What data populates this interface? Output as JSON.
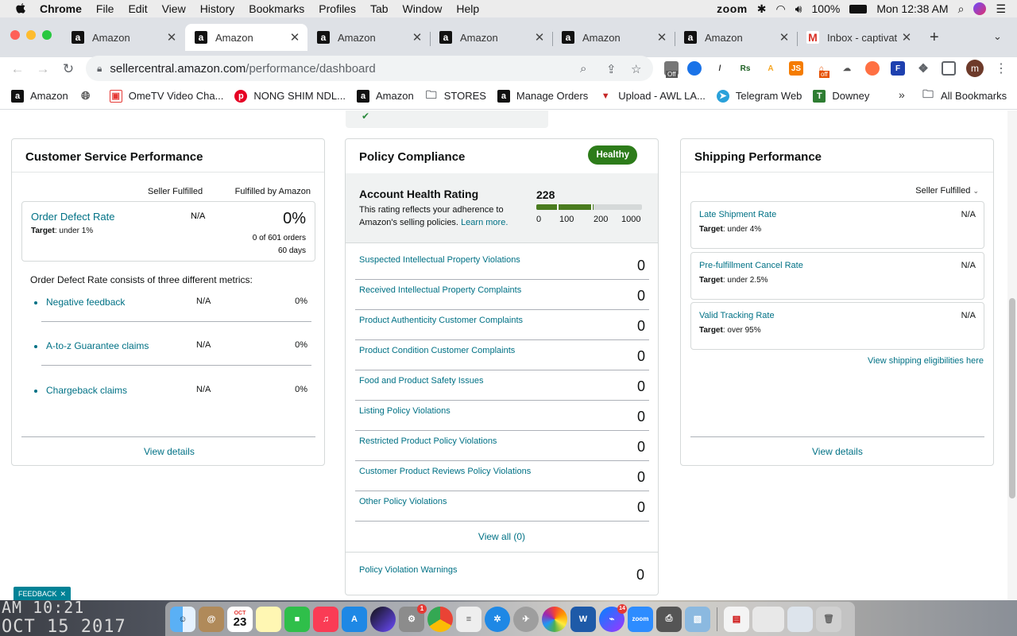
{
  "menubar": {
    "app": "Chrome",
    "items": [
      "File",
      "Edit",
      "View",
      "History",
      "Bookmarks",
      "Profiles",
      "Tab",
      "Window",
      "Help"
    ],
    "zoom": "zoom",
    "battery": "100%",
    "datetime": "Mon 12:38 AM"
  },
  "tabs": [
    {
      "title": "Amazon"
    },
    {
      "title": "Amazon"
    },
    {
      "title": "Amazon"
    },
    {
      "title": "Amazon"
    },
    {
      "title": "Amazon"
    },
    {
      "title": "Amazon"
    },
    {
      "title": "Inbox - captivat"
    }
  ],
  "address": {
    "host": "sellercentral.amazon.com",
    "path": "/performance/dashboard"
  },
  "bookmarks": [
    {
      "label": "Amazon"
    },
    {
      "label": ""
    },
    {
      "label": "OmeTV Video Cha..."
    },
    {
      "label": "NONG SHIM NDL..."
    },
    {
      "label": "Amazon"
    },
    {
      "label": "STORES"
    },
    {
      "label": "Manage Orders"
    },
    {
      "label": "Upload - AWL LA..."
    },
    {
      "label": "Telegram Web"
    },
    {
      "label": "Downey"
    }
  ],
  "bookmarks_more": "»",
  "all_bookmarks": "All Bookmarks",
  "extensions": {
    "badge_off1": "Off",
    "badge_off2": "off"
  },
  "avatar_letter": "m",
  "customer_service": {
    "title": "Customer Service Performance",
    "col_seller": "Seller Fulfilled",
    "col_fba": "Fulfilled by Amazon",
    "odr_title": "Order Defect Rate",
    "odr_target_label": "Target",
    "odr_target": ": under 1%",
    "odr_seller": "N/A",
    "odr_fba": "0%",
    "odr_orders": "0 of 601 orders",
    "odr_days": "60 days",
    "intro": "Order Defect Rate consists of three different metrics:",
    "metrics": [
      {
        "label": "Negative feedback",
        "seller": "N/A",
        "fba": "0%"
      },
      {
        "label": "A-to-z Guarantee claims",
        "seller": "N/A",
        "fba": "0%"
      },
      {
        "label": "Chargeback claims",
        "seller": "N/A",
        "fba": "0%"
      }
    ],
    "view_details": "View details"
  },
  "policy": {
    "title": "Policy Compliance",
    "badge": "Healthy",
    "ahr_title": "Account Health Rating",
    "ahr_desc1": "This rating reflects your adherence to",
    "ahr_desc2": "Amazon's selling policies.",
    "learn_more": "Learn more.",
    "score": "228",
    "ticks": [
      "0",
      "100",
      "200",
      "1000"
    ],
    "rows": [
      {
        "label": "Suspected Intellectual Property Violations",
        "value": "0"
      },
      {
        "label": "Received Intellectual Property Complaints",
        "value": "0"
      },
      {
        "label": "Product Authenticity Customer Complaints",
        "value": "0"
      },
      {
        "label": "Product Condition Customer Complaints",
        "value": "0"
      },
      {
        "label": "Food and Product Safety Issues",
        "value": "0"
      },
      {
        "label": "Listing Policy Violations",
        "value": "0"
      },
      {
        "label": "Restricted Product Policy Violations",
        "value": "0"
      },
      {
        "label": "Customer Product Reviews Policy Violations",
        "value": "0"
      },
      {
        "label": "Other Policy Violations",
        "value": "0"
      }
    ],
    "view_all": "View all (0)",
    "warnings_label": "Policy Violation Warnings",
    "warnings_value": "0"
  },
  "shipping": {
    "title": "Shipping Performance",
    "dropdown": "Seller Fulfilled",
    "metrics": [
      {
        "label": "Late Shipment Rate",
        "target_label": "Target",
        "target": ": under 4%",
        "value": "N/A"
      },
      {
        "label": "Pre-fulfillment Cancel Rate",
        "target_label": "Target",
        "target": ": under 2.5%",
        "value": "N/A"
      },
      {
        "label": "Valid Tracking Rate",
        "target_label": "Target",
        "target": ": over 95%",
        "value": "N/A"
      }
    ],
    "eligibilities": "View shipping eligibilities here",
    "view_details": "View details"
  },
  "feedback": "FEEDBACK",
  "desktop": {
    "line1": "AM 10:21",
    "line2": "OCT 15 2017"
  },
  "dock": {
    "calendar_month": "OCT",
    "calendar_day": "23",
    "settings_badge": "1",
    "messenger_badge": "14",
    "zoom_label": "zoom"
  }
}
